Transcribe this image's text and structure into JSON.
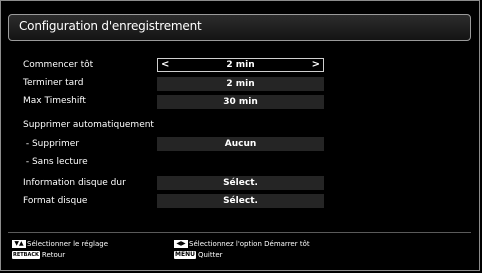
{
  "title": "Configuration d'enregistrement",
  "rows": [
    {
      "label": "Commencer tôt",
      "value": "2 min",
      "selected": true
    },
    {
      "label": "Terminer tard",
      "value": "2 min"
    },
    {
      "label": "Max Timeshift",
      "value": "30 min"
    },
    {
      "label": "Supprimer automatiquement",
      "value": null
    },
    {
      "label": " - Supprimer",
      "value": "Aucun"
    },
    {
      "label": " - Sans lecture",
      "value": null
    },
    {
      "label": "Information disque dur",
      "value": "Sélect."
    },
    {
      "label": "Format disque",
      "value": "Sélect."
    }
  ],
  "arrows": {
    "left": "<",
    "right": ">"
  },
  "footer": {
    "hint1_keys": "▼▲",
    "hint1_text": "Sélectionner le réglage",
    "hint2_key": "RETBACK",
    "hint2_text": "Retour",
    "hint3_keys": "◀▶",
    "hint3_text": "Sélectionnez l'option Démarrer tôt",
    "hint4_key": "MENU",
    "hint4_text": "Quitter"
  },
  "colors": {
    "background": "#000000",
    "value_bar": "#252525",
    "border": "#9a9a9a"
  }
}
